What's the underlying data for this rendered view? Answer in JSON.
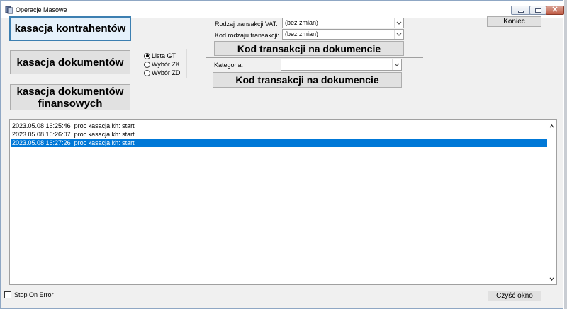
{
  "window": {
    "title": "Operacje Masowe"
  },
  "left_buttons": {
    "kasacja_kontrahentow": "kasacja kontrahentów",
    "kasacja_dokumentow": "kasacja dokumentów",
    "kasacja_dokumentow_finansowych_line1": "kasacja dokumentów",
    "kasacja_dokumentow_finansowych_line2": "finansowych"
  },
  "radio_group": {
    "options": [
      {
        "label": "Lista GT",
        "checked": true
      },
      {
        "label": "Wybór ZK",
        "checked": false
      },
      {
        "label": "Wybór ZD",
        "checked": false
      }
    ]
  },
  "vat_section": {
    "rodzaj_label": "Rodzaj transakcji VAT:",
    "rodzaj_value": "(bez zmian)",
    "kod_rodzaju_label": "Kod rodzaju transakcji:",
    "kod_rodzaju_value": "(bez zmian)",
    "kod_button": "Kod transakcji na dokumencie"
  },
  "kategoria_section": {
    "label": "Kategoria:",
    "value": "",
    "kod_button": "Kod transakcji na dokumencie"
  },
  "koniec_button": "Koniec",
  "log": {
    "rows": [
      {
        "text": "2023.05.08 16:25:46  proc kasacja kh: start",
        "selected": false
      },
      {
        "text": "2023.05.08 16:26:07  proc kasacja kh: start",
        "selected": false
      },
      {
        "text": "2023.05.08 16:27:26  proc kasacja kh: start",
        "selected": true
      }
    ]
  },
  "stop_on_error": {
    "label": "Stop On Error",
    "checked": false
  },
  "clear_button": "Czyść okno",
  "colors": {
    "selection": "#0078d7",
    "focus_border": "#3c7fb1",
    "face": "#f0f0f0"
  }
}
